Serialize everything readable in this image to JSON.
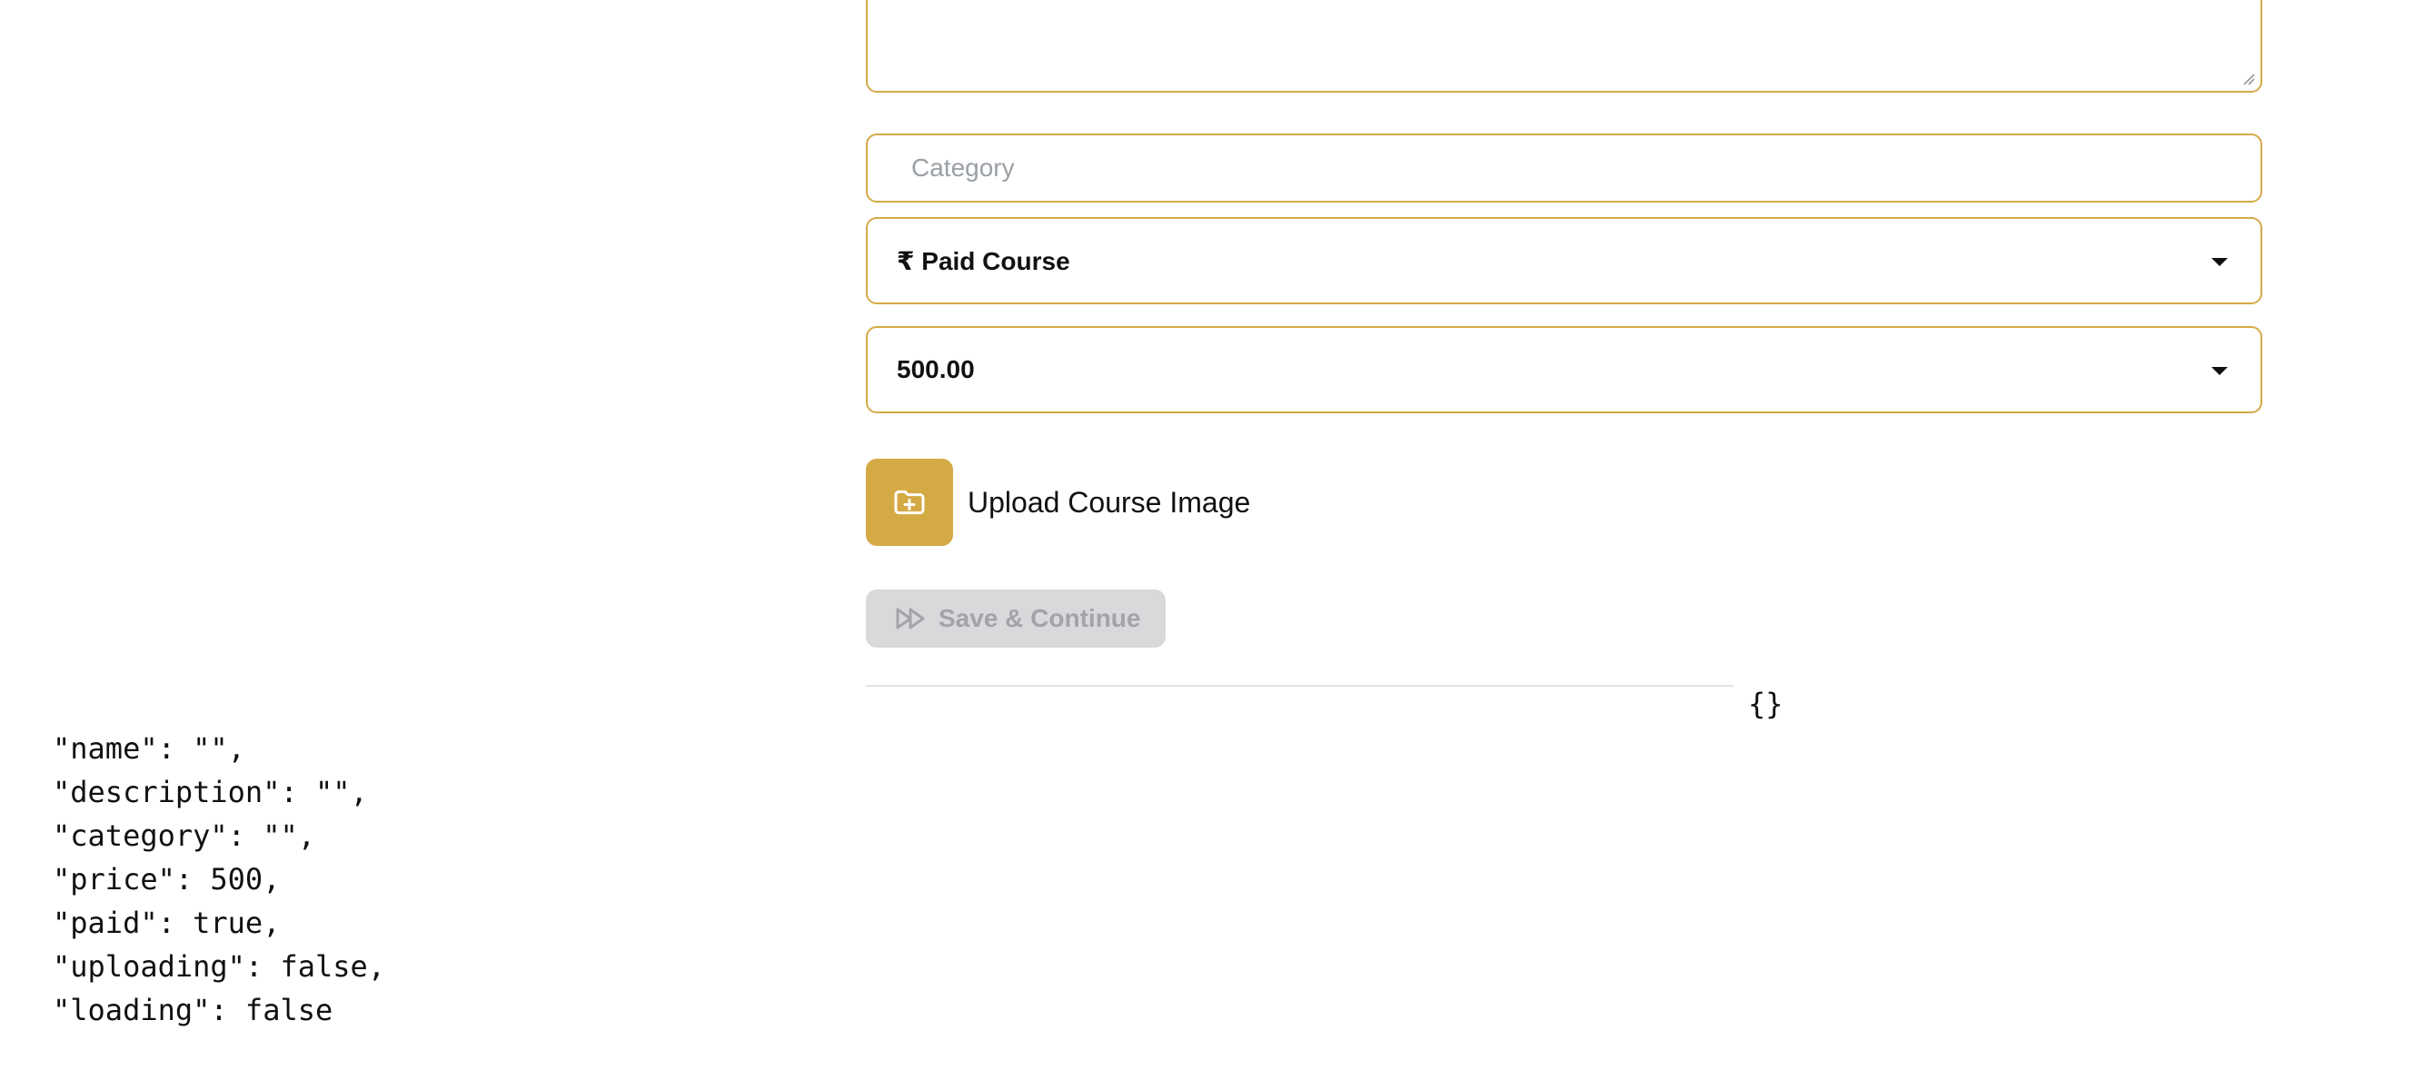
{
  "form": {
    "description_value": "",
    "category_placeholder": "Category",
    "course_type_selected": "₹ Paid Course",
    "price_selected": "500.00",
    "upload_label": "Upload Course Image",
    "save_label": "Save & Continue"
  },
  "debug": {
    "empty_object": "{}",
    "state_lines": [
      "\"name\": \"\",",
      "\"description\": \"\",",
      "\"category\": \"\",",
      "\"price\": 500,",
      "\"paid\": true,",
      "\"uploading\": false,",
      "\"loading\": false"
    ]
  },
  "icons": {
    "upload": "folder-plus-icon",
    "save": "fast-forward-icon",
    "select_caret": "caret-down-icon",
    "resize": "resize-grip-icon"
  },
  "colors": {
    "accent": "#d4aa45",
    "disabled_bg": "#d9d9dc",
    "disabled_text": "#a3a3a8",
    "placeholder": "#9aa0a6"
  }
}
